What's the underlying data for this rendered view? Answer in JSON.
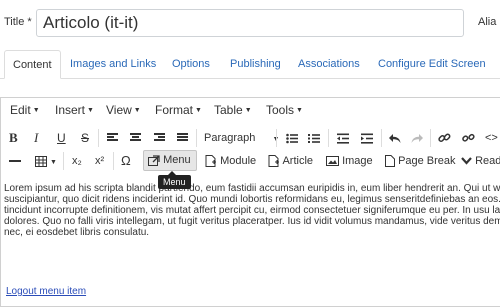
{
  "title_field": {
    "label": "Title",
    "required_mark": " *",
    "value": "Articolo (it-it)"
  },
  "alias_label": "Alia",
  "tabs": [
    {
      "label": "Content",
      "active": true
    },
    {
      "label": "Images and Links"
    },
    {
      "label": "Options"
    },
    {
      "label": "Publishing"
    },
    {
      "label": "Associations"
    },
    {
      "label": "Configure Edit Screen"
    }
  ],
  "menubar": [
    "Edit",
    "Insert",
    "View",
    "Format",
    "Table",
    "Tools"
  ],
  "toolbar1": {
    "bold": "B",
    "italic": "I",
    "underline": "U",
    "strike": "S",
    "format_select": "Paragraph"
  },
  "toolbar2": {
    "subscript": "x₂",
    "superscript": "x²",
    "omega": "Ω",
    "menu": "Menu",
    "module": "Module",
    "article": "Article",
    "image": "Image",
    "page_break": "Page Break",
    "readmore": "Read"
  },
  "tooltip": "Menu",
  "content": {
    "line1": "Lorem ipsum ad his scripta blandit partiendo, eum fastidii accumsan euripidis in, eum liber hendrerit an. Qui ut wisi v",
    "line2": "suscipiantur, quo dicit ridens inciderint id. Quo mundi lobortis reformidans eu, legimus senseritdefiniebas an eos. Eu s",
    "line3": "tincidunt incorrupte definitionem, vis mutat affert percipit cu, eirmod consectetuer signiferumque eu per. In usu latine",
    "line4": "dolores. Quo no falli viris intellegam, ut fugit veritus placeratper. Ius id vidit volumus mandamus, vide veritus democr",
    "line5": "nec, ei eosdebet libris consulatu.",
    "link": "Logout menu item"
  }
}
